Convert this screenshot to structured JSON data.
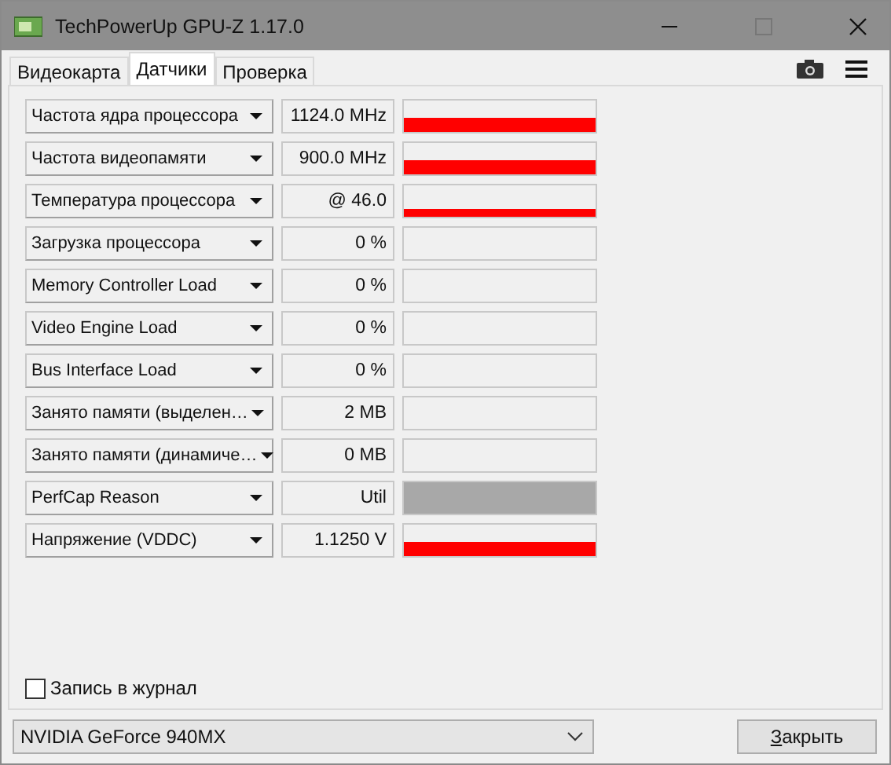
{
  "window": {
    "title": "TechPowerUp GPU-Z 1.17.0"
  },
  "tabs": [
    {
      "label": "Видеокарта",
      "selected": false
    },
    {
      "label": "Датчики",
      "selected": true
    },
    {
      "label": "Проверка",
      "selected": false
    }
  ],
  "sensors": [
    {
      "name": "Частота ядра процессора",
      "reading": "1124.0 MHz",
      "kind": "mid"
    },
    {
      "name": "Частота видеопамяти",
      "reading": "900.0 MHz",
      "kind": "mid"
    },
    {
      "name": "Температура процессора",
      "reading": "@ 46.0",
      "kind": "low"
    },
    {
      "name": "Загрузка процессора",
      "reading": "0 %",
      "kind": "none"
    },
    {
      "name": "Memory Controller Load",
      "reading": "0 %",
      "kind": "none"
    },
    {
      "name": "Video Engine Load",
      "reading": "0 %",
      "kind": "none"
    },
    {
      "name": "Bus Interface Load",
      "reading": "0 %",
      "kind": "none"
    },
    {
      "name": "Занято памяти (выделен…",
      "reading": "2 MB",
      "kind": "none"
    },
    {
      "name": "Занято памяти (динамиче…",
      "reading": "0 MB",
      "kind": "none"
    },
    {
      "name": "PerfCap Reason",
      "reading": "Util",
      "kind": "full"
    },
    {
      "name": "Напряжение (VDDC)",
      "reading": "1.1250 V",
      "kind": "mid"
    }
  ],
  "log": {
    "label": "Запись в журнал",
    "checked": false
  },
  "gpu_select": {
    "value": "NVIDIA GeForce 940MX"
  },
  "close_button": {
    "label": "Закрыть"
  }
}
